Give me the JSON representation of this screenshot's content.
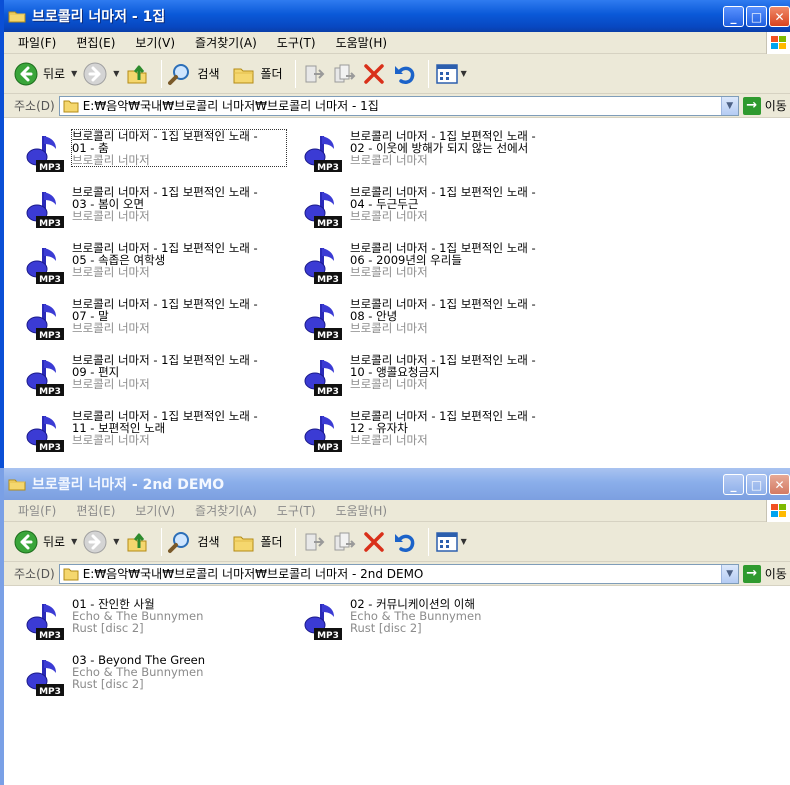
{
  "win1": {
    "title": "브로콜리 너마저 - 1집",
    "menu": [
      "파일(F)",
      "편집(E)",
      "보기(V)",
      "즐겨찾기(A)",
      "도구(T)",
      "도움말(H)"
    ],
    "toolbar": {
      "back": "뒤로",
      "search": "검색",
      "folders": "폴더"
    },
    "address": {
      "label": "주소(D)",
      "path": "E:₩음악₩국내₩브로콜리 너마저₩브로콜리 너마저 - 1집",
      "go": "이동"
    },
    "files": [
      {
        "line1": "브로콜리 너마저 - 1집 보편적인 노래 -",
        "line2": "01 - 춤",
        "artist": "브로콜리 너마저"
      },
      {
        "line1": "브로콜리 너마저 - 1집 보편적인 노래 -",
        "line2": "02 - 이웃에 방해가 되지 않는 선에서",
        "artist": "브로콜리 너마저"
      },
      {
        "line1": "브로콜리 너마저 - 1집 보편적인 노래 -",
        "line2": "03 - 봄이 오면",
        "artist": "브로콜리 너마저"
      },
      {
        "line1": "브로콜리 너마저 - 1집 보편적인 노래 -",
        "line2": "04 - 두근두근",
        "artist": "브로콜리 너마저"
      },
      {
        "line1": "브로콜리 너마저 - 1집 보편적인 노래 -",
        "line2": "05 - 속좁은 여학생",
        "artist": "브로콜리 너마저"
      },
      {
        "line1": "브로콜리 너마저 - 1집 보편적인 노래 -",
        "line2": "06 - 2009년의 우리들",
        "artist": "브로콜리 너마저"
      },
      {
        "line1": "브로콜리 너마저 - 1집 보편적인 노래 -",
        "line2": "07 - 말",
        "artist": "브로콜리 너마저"
      },
      {
        "line1": "브로콜리 너마저 - 1집 보편적인 노래 -",
        "line2": "08 - 안녕",
        "artist": "브로콜리 너마저"
      },
      {
        "line1": "브로콜리 너마저 - 1집 보편적인 노래 -",
        "line2": "09 - 편지",
        "artist": "브로콜리 너마저"
      },
      {
        "line1": "브로콜리 너마저 - 1집 보편적인 노래 -",
        "line2": "10 - 앵콜요청금지",
        "artist": "브로콜리 너마저"
      },
      {
        "line1": "브로콜리 너마저 - 1집 보편적인 노래 -",
        "line2": "11 - 보편적인 노래",
        "artist": "브로콜리 너마저"
      },
      {
        "line1": "브로콜리 너마저 - 1집 보편적인 노래 -",
        "line2": "12 - 유자차",
        "artist": "브로콜리 너마저"
      }
    ]
  },
  "win2": {
    "title": "브로콜리 너마저 - 2nd DEMO",
    "menu": [
      "파일(F)",
      "편집(E)",
      "보기(V)",
      "즐겨찾기(A)",
      "도구(T)",
      "도움말(H)"
    ],
    "toolbar": {
      "back": "뒤로",
      "search": "검색",
      "folders": "폴더"
    },
    "address": {
      "label": "주소(D)",
      "path": "E:₩음악₩국내₩브로콜리 너마저₩브로콜리 너마저 - 2nd DEMO",
      "go": "이동"
    },
    "files": [
      {
        "title": "01 - 잔인한 사월",
        "artist": "Echo & The Bunnymen",
        "album": "Rust [disc 2]"
      },
      {
        "title": "02 - 커뮤니케이션의 이해",
        "artist": "Echo & The Bunnymen",
        "album": "Rust [disc 2]"
      },
      {
        "title": "03 - Beyond The Green",
        "artist": "Echo & The Bunnymen",
        "album": "Rust [disc 2]"
      }
    ]
  },
  "icons": {
    "file": "mp3-file-icon",
    "mp3_badge": "MP3",
    "caption": [
      "minimize-icon",
      "maximize-icon",
      "close-icon"
    ]
  }
}
